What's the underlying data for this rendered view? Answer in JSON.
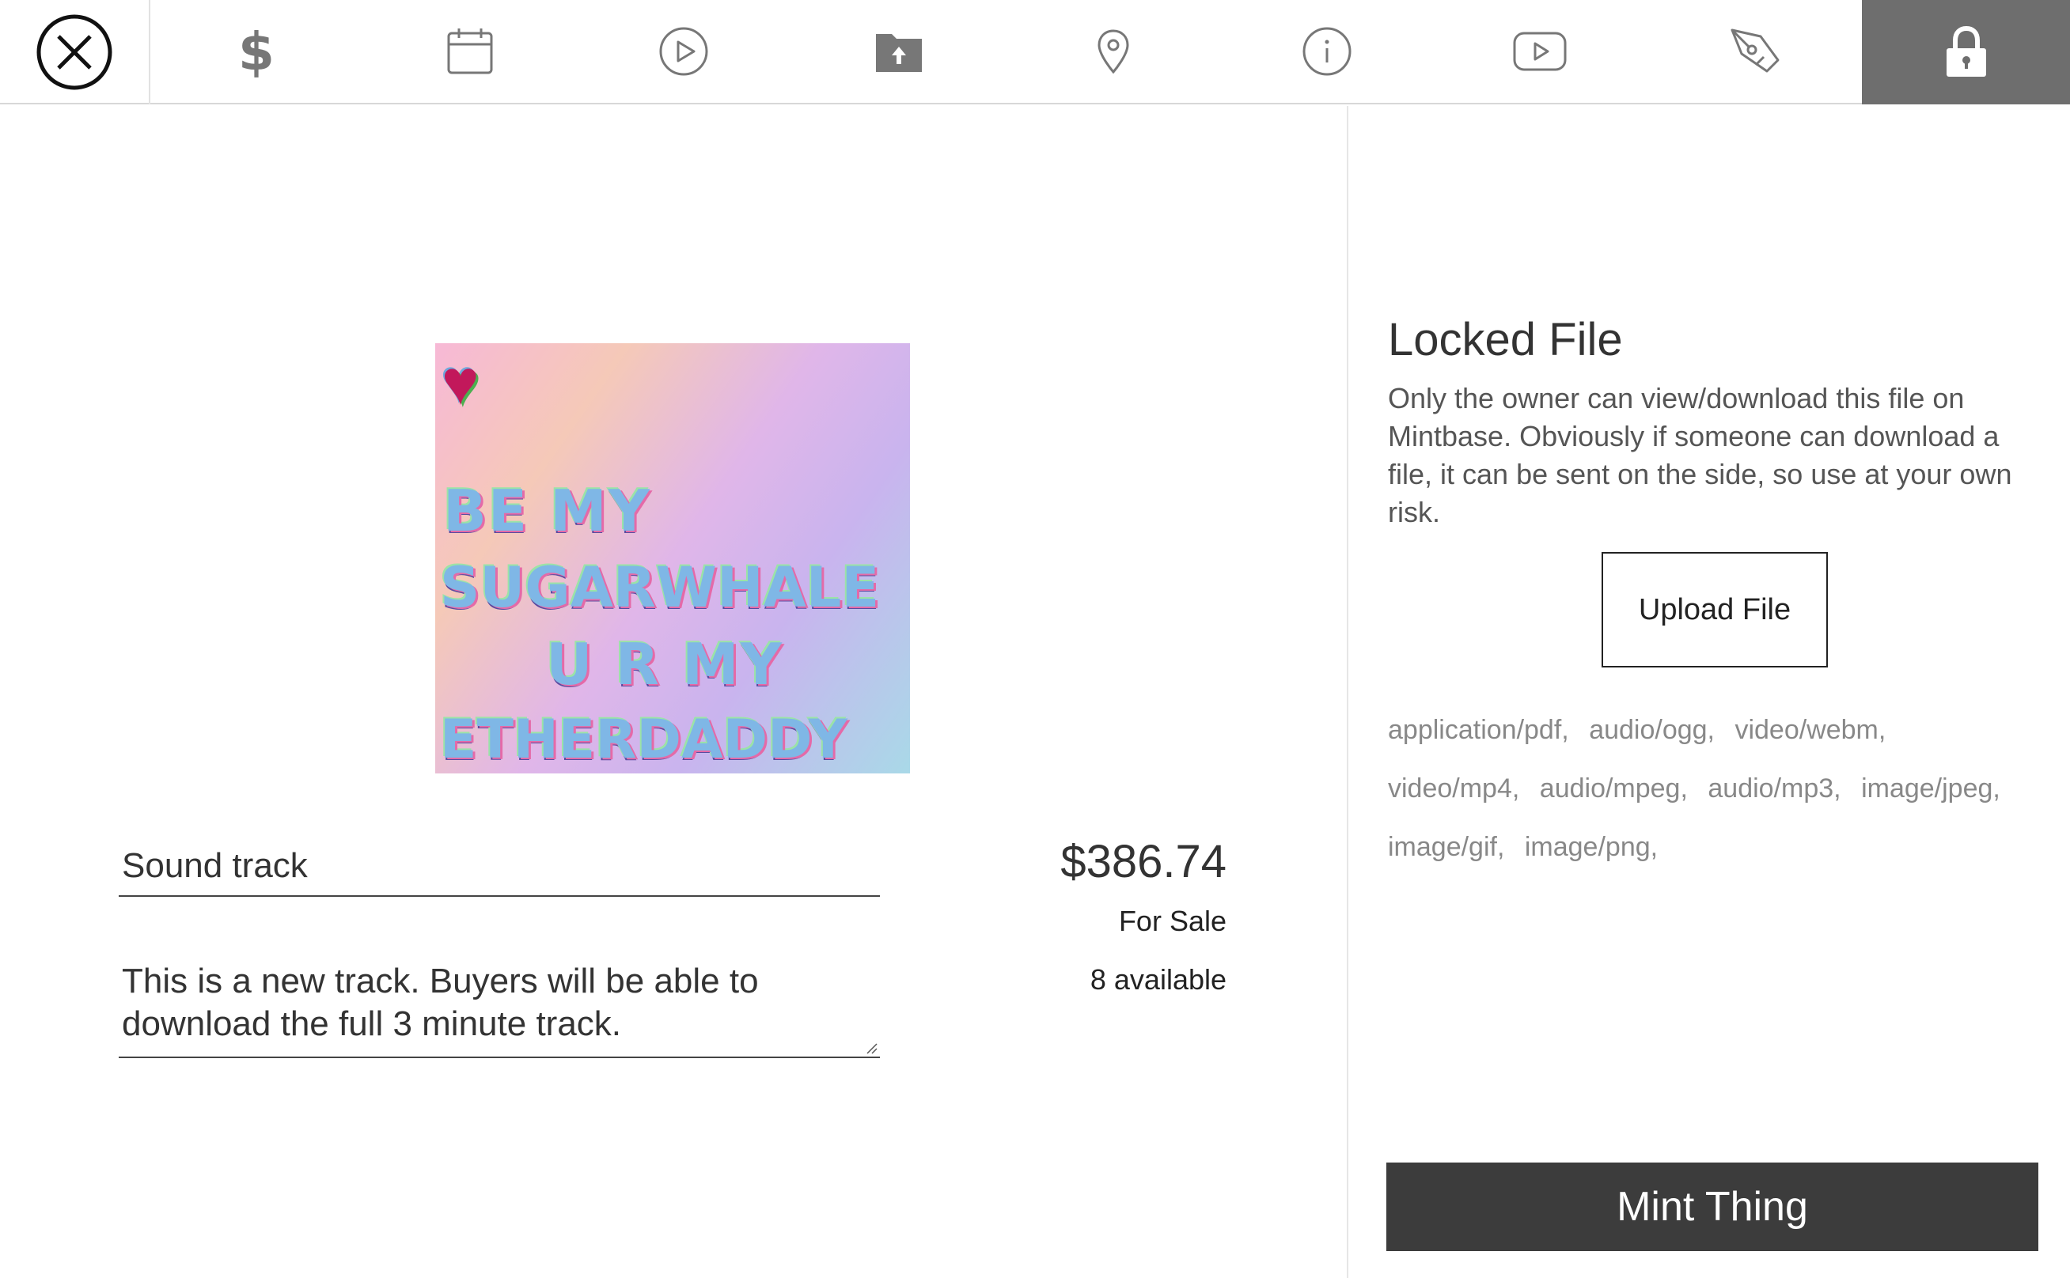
{
  "toolbar": {
    "icons": [
      {
        "name": "close-icon"
      },
      {
        "name": "dollar-icon"
      },
      {
        "name": "calendar-icon"
      },
      {
        "name": "play-circle-icon"
      },
      {
        "name": "folder-upload-icon"
      },
      {
        "name": "map-pin-icon"
      },
      {
        "name": "info-icon"
      },
      {
        "name": "youtube-icon"
      },
      {
        "name": "pen-tool-icon"
      },
      {
        "name": "lock-icon",
        "active": true
      }
    ],
    "dollar_glyph": "$",
    "active_bg": "#6e6e6e"
  },
  "artwork": {
    "lines": [
      "BE MY",
      "SUGARWHALE",
      "U R MY",
      "ETHERDADDY"
    ]
  },
  "form": {
    "title_value": "Sound track",
    "description_value": "This is a new track. Buyers will be able to download the full 3 minute track."
  },
  "pricing": {
    "price": "$386.74",
    "status": "For Sale",
    "available": "8 available"
  },
  "locked_file": {
    "title": "Locked File",
    "description": "Only the owner can view/download this file on Mintbase. Obviously if someone can download a file, it can be sent on the side, so use at your own risk.",
    "upload_label": "Upload File",
    "file_types": [
      "application/pdf,",
      "audio/ogg,",
      "video/webm,",
      "video/mp4,",
      "audio/mpeg,",
      "audio/mp3,",
      "image/jpeg,",
      "image/gif,",
      "image/png,"
    ]
  },
  "mint_button": {
    "label": "Mint Thing",
    "color": "#3c3c3c"
  }
}
